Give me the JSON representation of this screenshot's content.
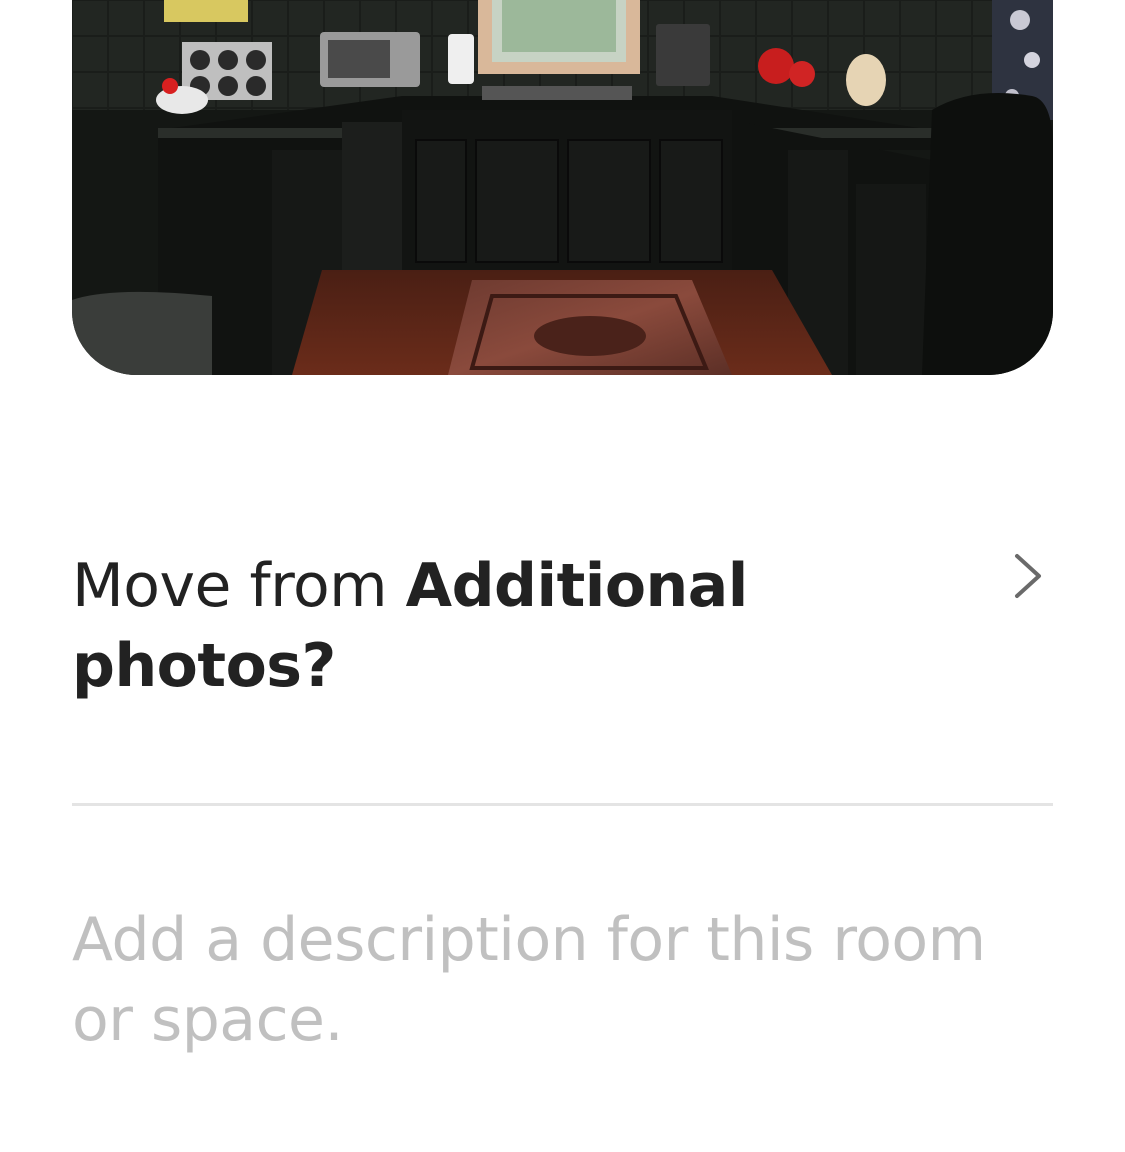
{
  "photo": {
    "alt": "kitchen-photo"
  },
  "move_prompt": {
    "prefix": "Move from ",
    "section": "Additional",
    "suffix": "photos?"
  },
  "description": {
    "placeholder": "Add a description for this room or space."
  },
  "colors": {
    "text_primary": "#222222",
    "placeholder": "#c0c0c0",
    "divider": "#e4e4e4",
    "chevron": "#6a6a6a"
  },
  "icons": {
    "chevron": "chevron-right-icon"
  }
}
